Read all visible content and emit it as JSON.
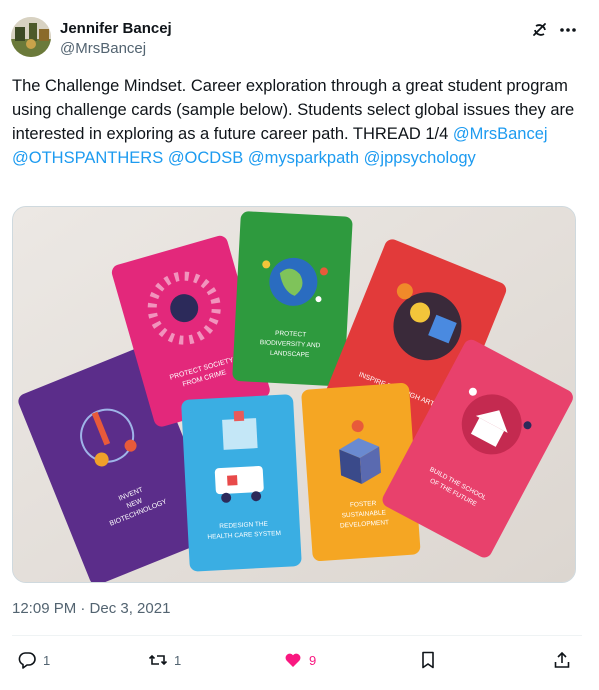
{
  "author": {
    "name": "Jennifer Bancej",
    "handle": "@MrsBancej"
  },
  "tweet": {
    "text_parts": [
      "The Challenge Mindset. Career exploration through a great student program using challenge cards (sample below). Students select global issues they are interested in exploring as a future career path. THREAD 1/4 ",
      "@MrsBancej",
      "@OTHSPANTHERS",
      "@OCDSB",
      "@mysparkpath",
      "@jppsychology"
    ],
    "timestamp": "12:09 PM · Dec 3, 2021"
  },
  "media": {
    "cards": [
      {
        "label_lines": [
          "INVENT",
          "NEW",
          "BIOTECHNOLOGY"
        ],
        "color": "#5b2d8a"
      },
      {
        "label_lines": [
          "PROTECT SOCIETY",
          "FROM CRIME"
        ],
        "color": "#e3287b"
      },
      {
        "label_lines": [
          "PROTECT",
          "BIODIVERSITY AND",
          "LANDSCAPE"
        ],
        "color": "#2e9a3e"
      },
      {
        "label_lines": [
          "INSPIRE THROUGH ART"
        ],
        "color": "#e23a3a"
      },
      {
        "label_lines": [
          "REDESIGN THE",
          "HEALTH CARE SYSTEM"
        ],
        "color": "#3aaee3"
      },
      {
        "label_lines": [
          "FOSTER",
          "SUSTAINABLE",
          "DEVELOPMENT"
        ],
        "color": "#f5a623"
      },
      {
        "label_lines": [
          "BUILD THE SCHOOL",
          "OF THE FUTURE"
        ],
        "color": "#e8416c"
      }
    ]
  },
  "actions": {
    "reply_count": "1",
    "retweet_count": "1",
    "like_count": "9"
  },
  "icons": [
    "grok-icon",
    "more-icon",
    "reply-icon",
    "retweet-icon",
    "like-icon",
    "bookmark-icon",
    "share-icon"
  ],
  "colors": {
    "accent": "#1d9bf0",
    "like": "#f91880",
    "muted": "#536471"
  }
}
